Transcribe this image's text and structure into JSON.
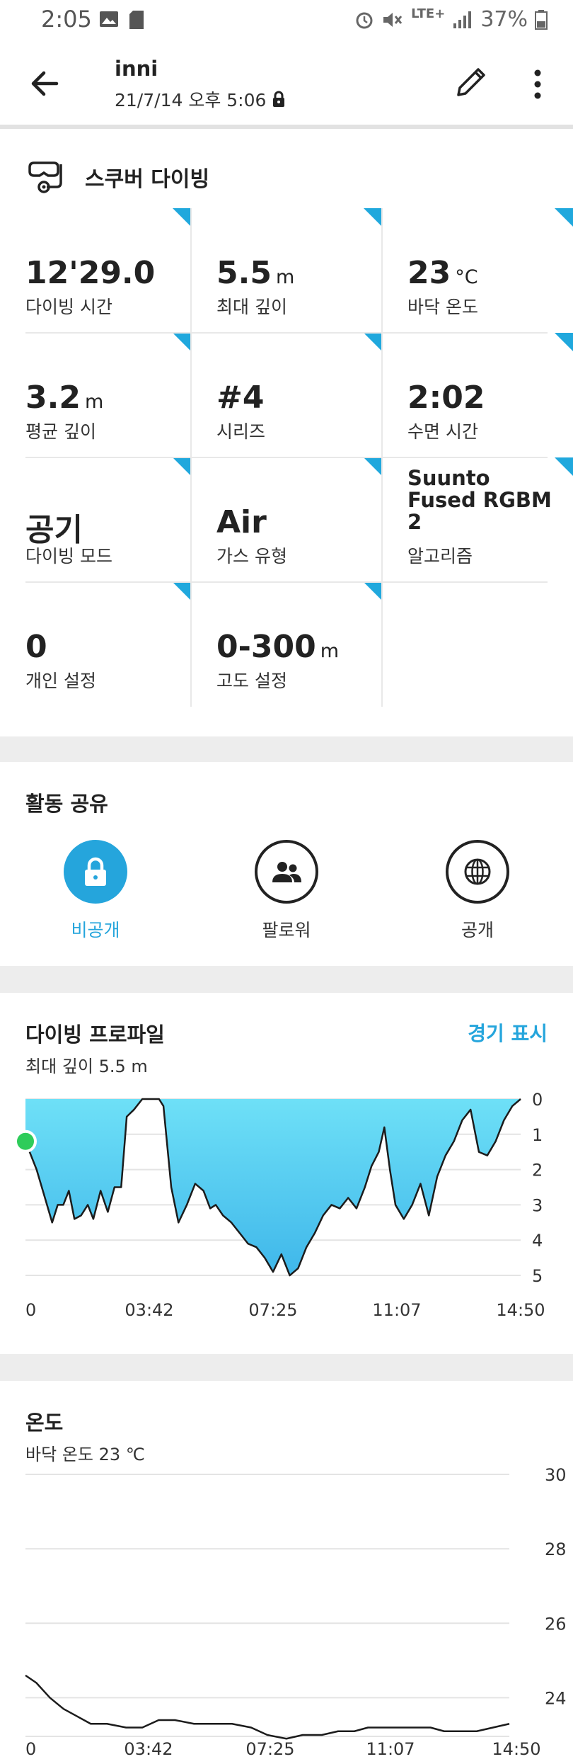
{
  "status_bar": {
    "time": "2:05",
    "network": "LTE+",
    "battery": "37%"
  },
  "header": {
    "title": "inni",
    "datetime": "21/7/14 오후 5:06"
  },
  "activity": {
    "title": "스쿠버 다이빙",
    "stats": [
      {
        "value": "12'29.0",
        "unit": "",
        "label": "다이빙 시간"
      },
      {
        "value": "5.5",
        "unit": "m",
        "label": "최대 깊이"
      },
      {
        "value": "23",
        "unit": "°C",
        "label": "바닥 온도"
      },
      {
        "value": "3.2",
        "unit": "m",
        "label": "평균 깊이"
      },
      {
        "value": "#4",
        "unit": "",
        "label": "시리즈"
      },
      {
        "value": "2:02",
        "unit": "",
        "label": "수면 시간"
      },
      {
        "value": "공기",
        "unit": "",
        "label": "다이빙 모드"
      },
      {
        "value": "Air",
        "unit": "",
        "label": "가스 유형"
      },
      {
        "value": "Suunto Fused RGBM 2",
        "unit": "",
        "label": "알고리즘"
      },
      {
        "value": "0",
        "unit": "",
        "label": "개인 설정"
      },
      {
        "value": "0-300",
        "unit": "m",
        "label": "고도 설정"
      }
    ]
  },
  "sharing": {
    "title": "활동 공유",
    "options": [
      {
        "label": "비공개",
        "icon": "lock-icon",
        "selected": true
      },
      {
        "label": "팔로워",
        "icon": "followers-icon",
        "selected": false
      },
      {
        "label": "공개",
        "icon": "globe-icon",
        "selected": false
      }
    ]
  },
  "colors": {
    "accent": "#25a5dc",
    "depth_fill": "#5cd3f2",
    "start_marker": "#2ecc5a"
  },
  "profile_chart": {
    "title": "다이빙 프로파일",
    "subtitle": "최대 깊이 5.5 m",
    "link": "경기 표시",
    "chart_data": {
      "type": "area",
      "x_ticks": [
        "0",
        "03:42",
        "07:25",
        "11:07",
        "14:50"
      ],
      "y_ticks": [
        "0",
        "1",
        "2",
        "3",
        "4",
        "5"
      ],
      "ylim": [
        0,
        5.3
      ],
      "y_inverted": true,
      "x_range_seconds": [
        0,
        890
      ],
      "series": [
        {
          "points": [
            [
              0,
              1.2
            ],
            [
              20,
              2.0
            ],
            [
              35,
              2.8
            ],
            [
              48,
              3.5
            ],
            [
              58,
              3.0
            ],
            [
              68,
              3.0
            ],
            [
              78,
              2.6
            ],
            [
              88,
              3.4
            ],
            [
              100,
              3.3
            ],
            [
              112,
              3.0
            ],
            [
              122,
              3.4
            ],
            [
              135,
              2.6
            ],
            [
              148,
              3.2
            ],
            [
              160,
              2.5
            ],
            [
              172,
              2.5
            ],
            [
              182,
              0.5
            ],
            [
              195,
              0.3
            ],
            [
              210,
              0
            ],
            [
              225,
              0
            ],
            [
              240,
              0
            ],
            [
              248,
              0.2
            ],
            [
              262,
              2.5
            ],
            [
              275,
              3.5
            ],
            [
              290,
              3.0
            ],
            [
              305,
              2.4
            ],
            [
              320,
              2.6
            ],
            [
              332,
              3.1
            ],
            [
              342,
              3.0
            ],
            [
              355,
              3.3
            ],
            [
              370,
              3.5
            ],
            [
              385,
              3.8
            ],
            [
              400,
              4.1
            ],
            [
              415,
              4.2
            ],
            [
              430,
              4.5
            ],
            [
              445,
              4.9
            ],
            [
              460,
              4.4
            ],
            [
              475,
              5.0
            ],
            [
              490,
              4.8
            ],
            [
              505,
              4.2
            ],
            [
              520,
              3.8
            ],
            [
              535,
              3.3
            ],
            [
              550,
              3.0
            ],
            [
              565,
              3.1
            ],
            [
              580,
              2.8
            ],
            [
              595,
              3.1
            ],
            [
              610,
              2.5
            ],
            [
              622,
              1.9
            ],
            [
              635,
              1.5
            ],
            [
              645,
              0.8
            ],
            [
              655,
              2.0
            ],
            [
              665,
              3.0
            ],
            [
              680,
              3.4
            ],
            [
              695,
              3.0
            ],
            [
              710,
              2.4
            ],
            [
              725,
              3.3
            ],
            [
              740,
              2.2
            ],
            [
              755,
              1.6
            ],
            [
              770,
              1.2
            ],
            [
              785,
              0.6
            ],
            [
              800,
              0.3
            ],
            [
              815,
              1.5
            ],
            [
              830,
              1.6
            ],
            [
              845,
              1.2
            ],
            [
              860,
              0.6
            ],
            [
              875,
              0.2
            ],
            [
              890,
              0
            ]
          ]
        }
      ]
    }
  },
  "temperature_chart": {
    "title": "온도",
    "subtitle": "바닥 온도 23 ℃",
    "chart_data": {
      "type": "line",
      "x_ticks": [
        "0",
        "03:42",
        "07:25",
        "11:07",
        "14:50"
      ],
      "y_ticks": [
        "30",
        "28",
        "26",
        "24"
      ],
      "ylim": [
        23.0,
        30.0
      ],
      "x_range_seconds": [
        0,
        890
      ],
      "series": [
        {
          "points": [
            [
              0,
              24.6
            ],
            [
              20,
              24.4
            ],
            [
              45,
              24.0
            ],
            [
              70,
              23.7
            ],
            [
              95,
              23.5
            ],
            [
              120,
              23.3
            ],
            [
              150,
              23.3
            ],
            [
              185,
              23.2
            ],
            [
              215,
              23.2
            ],
            [
              245,
              23.4
            ],
            [
              275,
              23.4
            ],
            [
              310,
              23.3
            ],
            [
              345,
              23.3
            ],
            [
              380,
              23.3
            ],
            [
              415,
              23.2
            ],
            [
              445,
              23.0
            ],
            [
              480,
              22.9
            ],
            [
              510,
              23.0
            ],
            [
              545,
              23.0
            ],
            [
              575,
              23.1
            ],
            [
              605,
              23.1
            ],
            [
              630,
              23.2
            ],
            [
              660,
              23.2
            ],
            [
              690,
              23.2
            ],
            [
              720,
              23.2
            ],
            [
              745,
              23.2
            ],
            [
              770,
              23.1
            ],
            [
              800,
              23.1
            ],
            [
              830,
              23.1
            ],
            [
              860,
              23.2
            ],
            [
              890,
              23.3
            ]
          ]
        }
      ]
    }
  }
}
